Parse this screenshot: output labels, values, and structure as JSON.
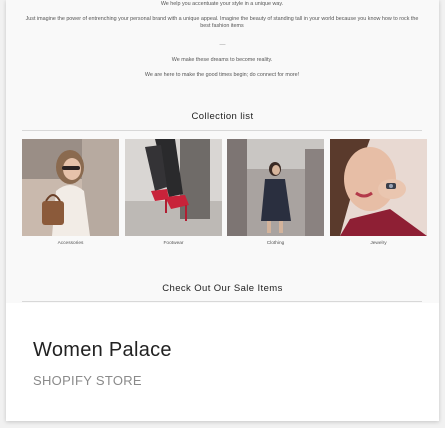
{
  "intro": {
    "line_top": "We help you accentuate your style in a unique way.",
    "line_power": "Just imagine the power of entrenching your personal brand with a unique appeal. Imagine the beauty of standing tall in your world because you know how to rock the best fashion items",
    "separator": "—",
    "line_dreams": "We make these dreams to become reality.",
    "line_connect": "We are here to make the good times begin; do connect for more!"
  },
  "collection": {
    "title": "Collection list",
    "items": [
      {
        "label": "Accessories",
        "icon": "woman-with-handbag-photo"
      },
      {
        "label": "Footwear",
        "icon": "red-heels-photo"
      },
      {
        "label": "Clothing",
        "icon": "woman-in-dress-photo"
      },
      {
        "label": "Jewelry",
        "icon": "woman-with-ring-photo"
      }
    ]
  },
  "sale": {
    "title": "Check Out Our Sale Items"
  },
  "store": {
    "name": "Women Palace",
    "type": "SHOPIFY STORE"
  },
  "colors": {
    "card_bg": "#ffffff",
    "preview_bg": "#f9f9f9",
    "title_text": "#222222",
    "muted_text": "#8a8a8a"
  }
}
